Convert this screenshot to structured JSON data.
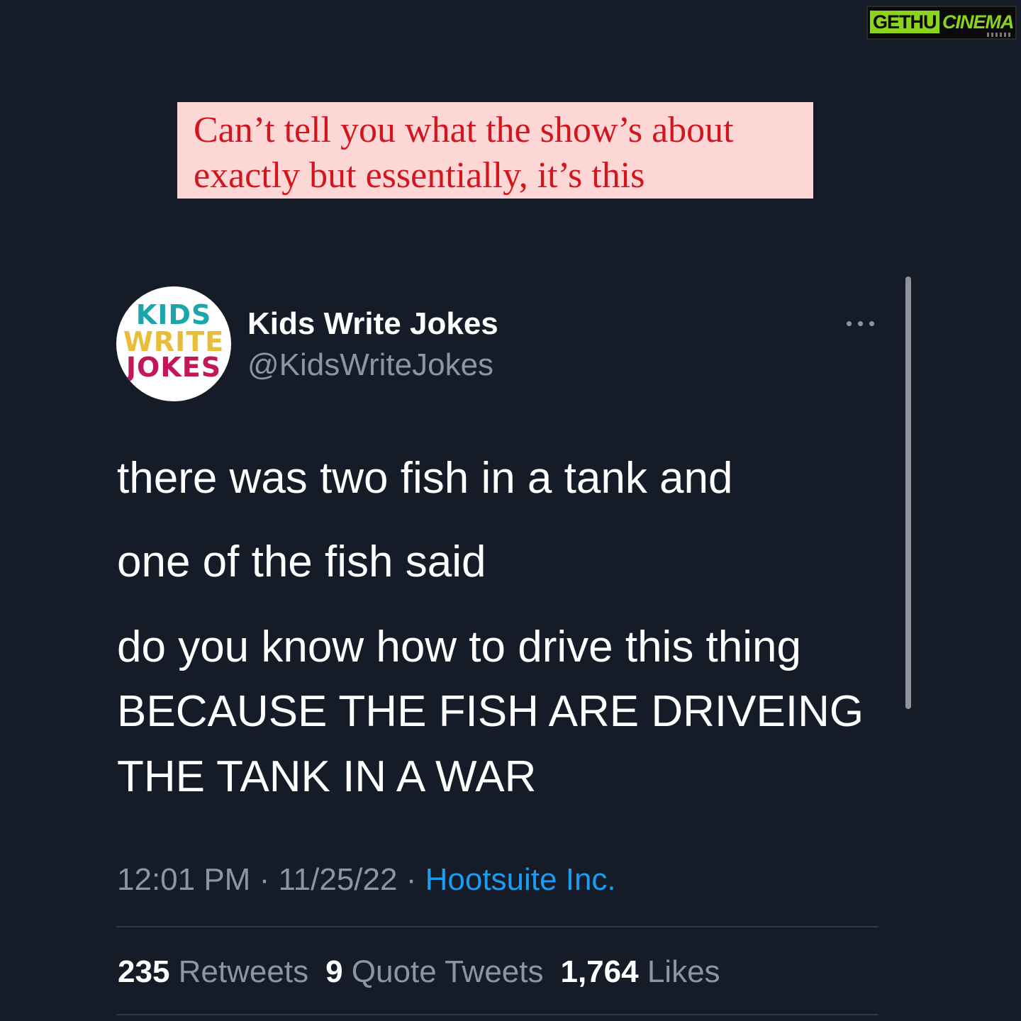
{
  "watermark": {
    "part1": "GETHU",
    "part2": "CINEMA"
  },
  "caption": {
    "line1": "Can’t tell you what the show’s about",
    "line2": "exactly but essentially, it’s this"
  },
  "tweet": {
    "avatar": {
      "line1": "KIDS",
      "line2": "WRITE",
      "line3": "JOKES"
    },
    "display_name": "Kids Write Jokes",
    "handle": "@KidsWriteJokes",
    "body_lines": [
      "there was two fish in a tank and",
      "one of the fish said",
      "do you know how to drive this thing",
      "BECAUSE THE FISH ARE DRIVEING",
      "THE TANK IN A WAR"
    ],
    "time": "12:01 PM",
    "separator": "·",
    "date": "11/25/22",
    "source": "Hootsuite Inc.",
    "stats": {
      "retweets_count": "235",
      "retweets_label": "Retweets",
      "quotes_count": "9",
      "quotes_label": "Quote Tweets",
      "likes_count": "1,764",
      "likes_label": "Likes"
    }
  },
  "colors": {
    "background": "#151c27",
    "caption_bg": "#fdd7d5",
    "caption_text": "#d3151e",
    "link": "#1d9bf0",
    "secondary_text": "#8b96a2"
  }
}
